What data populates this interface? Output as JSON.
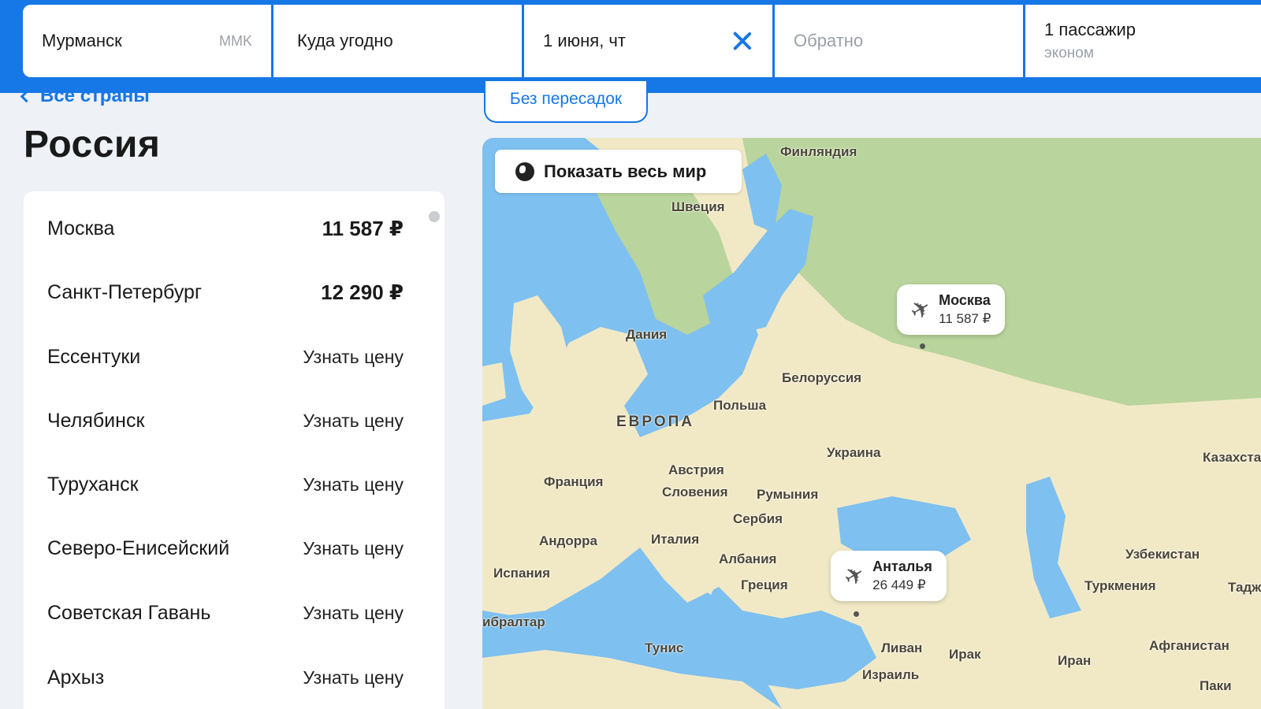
{
  "search": {
    "origin": "Мурманск",
    "origin_code": "MMK",
    "destination": "Куда угодно",
    "depart_date": "1 июня, чт",
    "return_placeholder": "Обратно",
    "passengers": "1 пассажир",
    "cabin_class": "эконом"
  },
  "nav": {
    "back_label": "Все страны"
  },
  "country": {
    "title": "Россия"
  },
  "filter": {
    "nonstop_label": "Без пересадок"
  },
  "destinations": [
    {
      "city": "Москва",
      "price": "11 587 ₽",
      "has_price": true
    },
    {
      "city": "Санкт-Петербург",
      "price": "12 290 ₽",
      "has_price": true
    },
    {
      "city": "Ессентуки",
      "price": "Узнать цену",
      "has_price": false
    },
    {
      "city": "Челябинск",
      "price": "Узнать цену",
      "has_price": false
    },
    {
      "city": "Туруханск",
      "price": "Узнать цену",
      "has_price": false
    },
    {
      "city": "Северо-Енисейский",
      "price": "Узнать цену",
      "has_price": false
    },
    {
      "city": "Советская Гавань",
      "price": "Узнать цену",
      "has_price": false
    },
    {
      "city": "Архыз",
      "price": "Узнать цену",
      "has_price": false
    }
  ],
  "map": {
    "show_world_label": "Показать весь мир",
    "labels": {
      "finland": "Финляндия",
      "sweden": "Швеция",
      "denmark": "Дания",
      "belarus": "Белоруссия",
      "poland": "Польша",
      "europe": "ЕВРОПА",
      "ukraine": "Украина",
      "kazakhstan": "Казахста",
      "france": "Франция",
      "austria": "Австрия",
      "slovenia": "Словения",
      "romania": "Румыния",
      "serbia": "Сербия",
      "andorra": "Андорра",
      "italy": "Италия",
      "albania": "Албания",
      "spain": "Испания",
      "greece": "Греция",
      "gibraltar": "ибралтар",
      "tunisia": "Тунис",
      "lebanon": "Ливан",
      "iraq": "Ирак",
      "iran": "Иран",
      "israel": "Израиль",
      "uzbekistan": "Узбекистан",
      "turkmenistan": "Туркмения",
      "tajikistan": "Тадж",
      "afghanistan": "Афганистан",
      "pakistan": "Паки"
    },
    "pins": [
      {
        "city": "Москва",
        "price": "11 587 ₽"
      },
      {
        "city": "Анталья",
        "price": "26 449 ₽"
      }
    ]
  },
  "colors": {
    "brand": "#1677e6",
    "sea": "#7ec0f0",
    "land": "#f1e9c6",
    "forest": "#b9d49c"
  }
}
